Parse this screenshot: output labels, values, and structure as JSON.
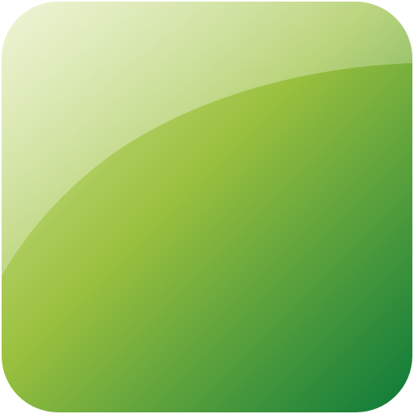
{
  "icon": {
    "name": "green-glossy-square-button-icon",
    "colors": {
      "top_left": "#d9e8a4",
      "middle": "#9ac03e",
      "bottom_right": "#0a7a3a",
      "gloss_highlight": "#ffffff"
    }
  }
}
